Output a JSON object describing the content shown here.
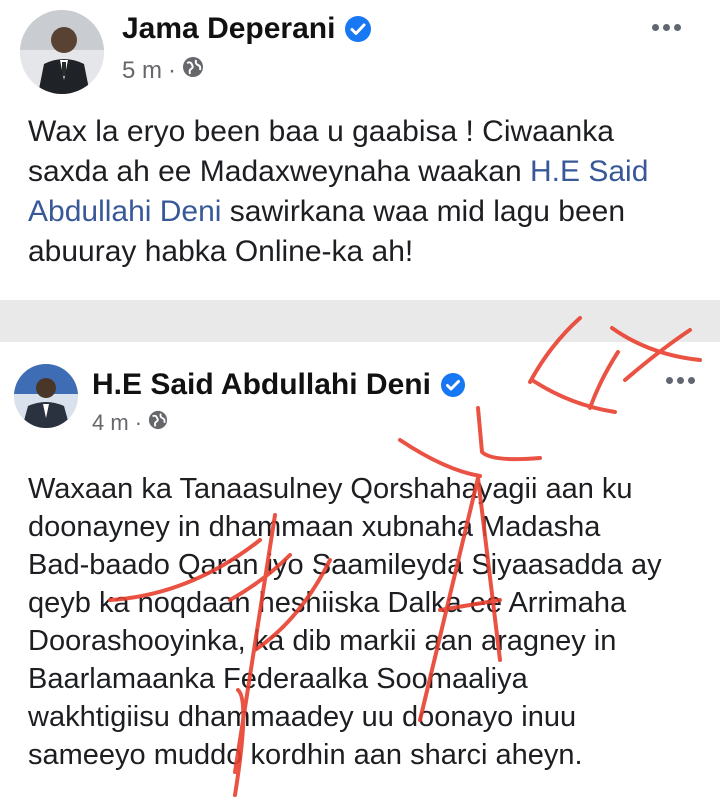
{
  "post1": {
    "author": "Jama Deperani",
    "time": "5 m",
    "dot": "·",
    "text_lines": [
      "Wax la eryo been baa u gaabisa ! Ciwaanka",
      "saxda ah ee Madaxweynaha waakan "
    ],
    "mention_line2": "H.E Said",
    "mention_line3": "Abdullahi Deni",
    "line3_rest": " sawirkana waa mid lagu been",
    "line4": "abuuray habka Online-ka ah!"
  },
  "post2": {
    "author": "H.E Said Abdullahi Deni",
    "time": "4 m",
    "dot": "·",
    "text_lines": [
      "Waxaan ka Tanaasulney Qorshahayagii aan ku",
      "doonayney in dhammaan xubnaha Madasha",
      "Bad-baado Qaran iyo Saamileyda Siyaasadda ay",
      "qeyb ka noqdaan heshiiska Dalka ee Arrimaha",
      "Doorashooyinka, ka dib markii aan aragney in",
      "Baarlamaanka Federaalka Soomaaliya",
      "wakhtigiisu dhammaadey uu doonayo inuu",
      "sameeyo muddo kordhin aan sharci aheyn."
    ]
  },
  "colors": {
    "verified": "#1877f2",
    "mention": "#385898",
    "stamp_red": "#e8402f",
    "separator": "#e9e9ea"
  },
  "icons": [
    "verified-badge-icon",
    "globe-icon",
    "more-options-icon"
  ]
}
